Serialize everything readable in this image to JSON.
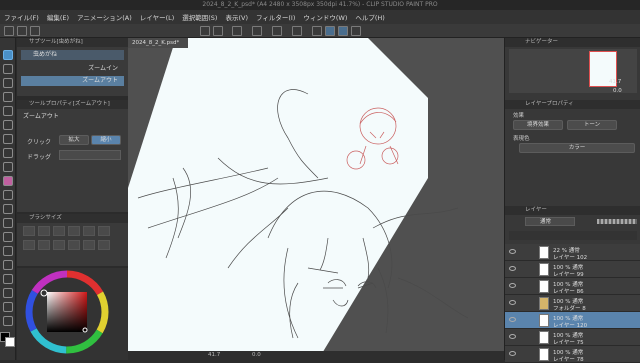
{
  "window": {
    "title": "2024_8_2_K_psd* (A4 2480 x 3508px 350dpi 41.7%) - CLIP STUDIO PAINT PRO"
  },
  "menu": [
    "ファイル(F)",
    "編集(E)",
    "アニメーション(A)",
    "レイヤー(L)",
    "選択範囲(S)",
    "表示(V)",
    "フィルター(I)",
    "ウィンドウ(W)",
    "ヘルプ(H)"
  ],
  "subtool": {
    "header": "サブツール[虫めがね]",
    "group": "虫めがね",
    "items": [
      "ズームイン",
      "ズームアウト"
    ]
  },
  "toolprop": {
    "header": "ツールプロパティ[ズームアウト]",
    "name": "ズームアウト",
    "click_label": "クリック",
    "option_in": "拡大",
    "option_out": "縮小",
    "drag_label": "ドラッグ"
  },
  "brushsize": {
    "header": "ブラシサイズ"
  },
  "canvas": {
    "tab": "2024_8_2_K.psd*"
  },
  "statusbar": {
    "zoom": "41.7",
    "angle": "0.0"
  },
  "navigator": {
    "header": "ナビゲーター",
    "zoom": "41.7",
    "angle": "0.0"
  },
  "layerprop": {
    "header": "レイヤープロパティ",
    "effect_label": "効果",
    "border_btn": "境界効果",
    "tone_btn": "トーン",
    "color_label": "表現色",
    "color_value": "カラー"
  },
  "layers": {
    "header": "レイヤー",
    "blend_mode": "通常",
    "opacity": "100",
    "rows": [
      {
        "line1": "22 % 通常",
        "line2": "レイヤー 102"
      },
      {
        "line1": "100 % 通常",
        "line2": "レイヤー 99"
      },
      {
        "line1": "100 % 通常",
        "line2": "レイヤー 86"
      },
      {
        "line1": "100 % 通常",
        "line2": "フォルダー 8"
      },
      {
        "line1": "100 % 通常",
        "line2": "レイヤー 120"
      },
      {
        "line1": "100 % 通常",
        "line2": "レイヤー 75"
      },
      {
        "line1": "100 % 通常",
        "line2": "レイヤー 78"
      }
    ]
  },
  "colors": {
    "main": "#000000",
    "sub": "#ffffff",
    "accent": "#4a90c8",
    "sel_layer": "#5a84ad"
  }
}
